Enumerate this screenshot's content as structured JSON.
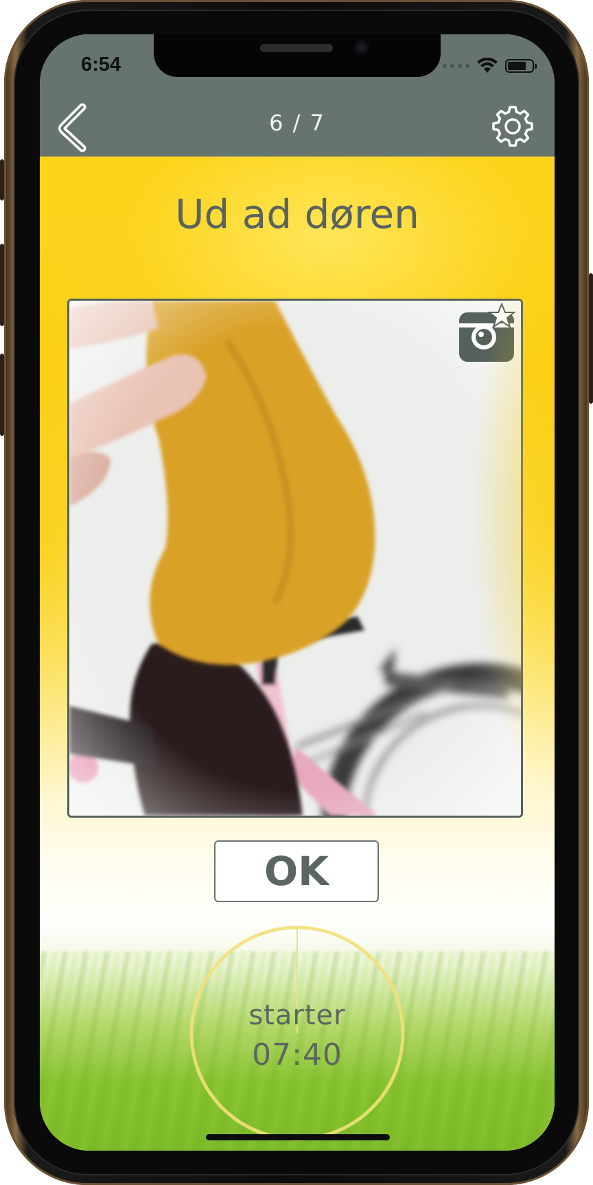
{
  "status_bar": {
    "time": "6:54",
    "icons": [
      "cellular-dots-icon",
      "wifi-icon",
      "battery-icon"
    ]
  },
  "header": {
    "back_icon": "chevron-left-icon",
    "page_counter": "6 / 7",
    "settings_icon": "gear-icon",
    "background_color": "#67736d"
  },
  "main": {
    "title": "Ud ad døren",
    "photo": {
      "description": "person-on-bicycle-photo",
      "camera_button_icon": "camera-star-icon"
    },
    "ok_label": "OK",
    "timer": {
      "label": "starter",
      "time": "07:40",
      "ring_color": "#f2e07a"
    }
  },
  "colors": {
    "accent_yellow": "#fcd21e",
    "text_gray": "#5c6661",
    "grass_green": "#7bba26"
  }
}
